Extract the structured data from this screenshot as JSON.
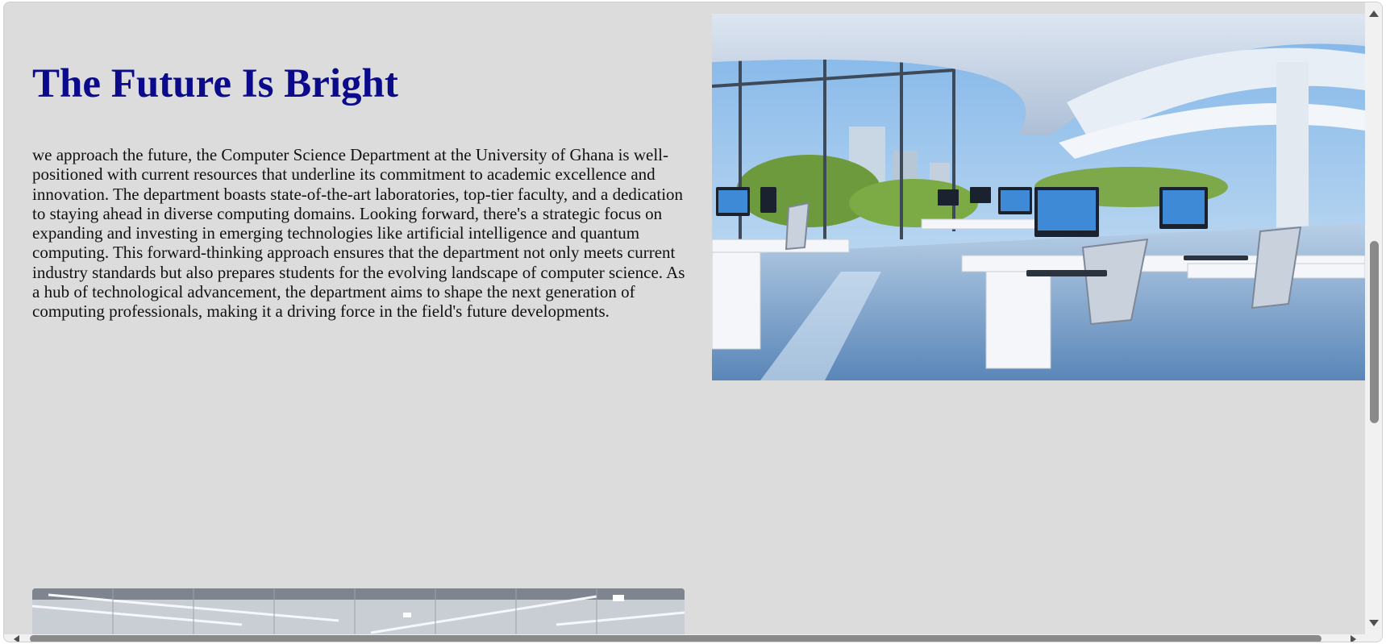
{
  "section": {
    "title": "The Future Is Bright",
    "body": "we approach the future, the Computer Science Department at the University of Ghana is well-positioned with current resources that underline its commitment to academic excellence and innovation. The department boasts state-of-the-art laboratories, top-tier faculty, and a dedication to staying ahead in diverse computing domains. Looking forward, there's a strategic focus on expanding and investing in emerging technologies like artificial intelligence and quantum computing. This forward-thinking approach ensures that the department not only meets current industry standards but also prepares students for the evolving landscape of computer science. As a hub of technological advancement, the department aims to shape the next generation of computing professionals, making it a driving force in the field's future developments."
  },
  "colors": {
    "page_background": "#dcdcdc",
    "title_color": "#0a0a8a",
    "text_color": "#111111",
    "scrollbar_thumb": "#8a8a8a",
    "scrollbar_track": "#f1f1f1"
  },
  "icons": {
    "scroll_up": "triangle-up-icon",
    "scroll_down": "triangle-down-icon",
    "scroll_left": "triangle-left-icon",
    "scroll_right": "triangle-right-icon"
  }
}
